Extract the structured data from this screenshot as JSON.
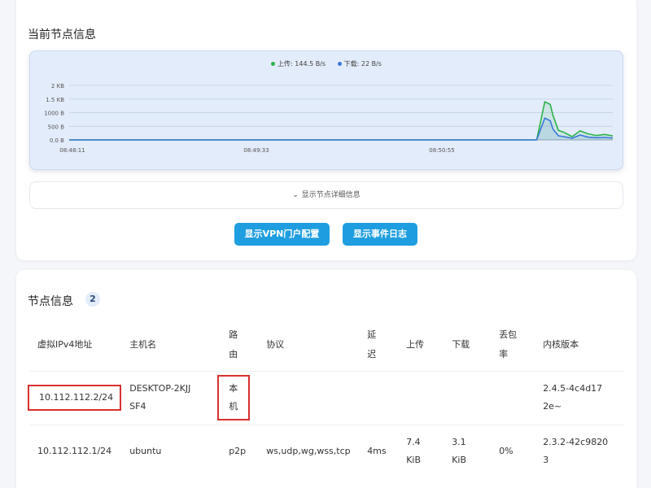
{
  "current_node": {
    "title": "当前节点信息",
    "detail_toggle": "显示节点详细信息",
    "buttons": {
      "vpn": "显示VPN门户配置",
      "log": "显示事件日志"
    }
  },
  "chart_data": {
    "type": "line",
    "series": [
      {
        "name": "上传: 144.5 B/s",
        "color": "#2bb34a",
        "x": [
          0,
          0.5,
          0.86,
          0.875,
          0.885,
          0.89,
          0.9,
          0.91,
          0.925,
          0.94,
          0.955,
          0.97,
          0.985,
          1
        ],
        "y": [
          0,
          0,
          0,
          1400,
          1300,
          900,
          350,
          280,
          120,
          330,
          220,
          160,
          200,
          150
        ]
      },
      {
        "name": "下载: 22 B/s",
        "color": "#3a78d8",
        "x": [
          0,
          0.5,
          0.86,
          0.875,
          0.885,
          0.89,
          0.9,
          0.91,
          0.925,
          0.94,
          0.955,
          0.97,
          0.985,
          1
        ],
        "y": [
          0,
          0,
          0,
          800,
          700,
          400,
          150,
          120,
          60,
          180,
          100,
          80,
          90,
          70
        ]
      }
    ],
    "y_ticks": [
      "2 KB",
      "1.5 KB",
      "1000 B",
      "500 B",
      "0.0 B"
    ],
    "x_ticks": [
      "08:48:11",
      "08:49:33",
      "08:50:55"
    ],
    "ylim": [
      0,
      2000
    ],
    "grid": true,
    "legend": "top"
  },
  "nodes": {
    "title": "节点信息",
    "count": "2",
    "columns": [
      "虚拟IPv4地址",
      "主机名",
      "路由",
      "协议",
      "延迟",
      "上传",
      "下载",
      "丢包率",
      "内核版本"
    ],
    "rows": [
      {
        "ip": "10.112.112.2/24",
        "hostname": "DESKTOP-2KJJSF4",
        "route": "本机",
        "protocol": "",
        "latency": "",
        "upload": "",
        "download": "",
        "loss": "",
        "version": "2.4.5-4c4d172e~"
      },
      {
        "ip": "10.112.112.1/24",
        "hostname": "ubuntu",
        "route": "p2p",
        "protocol": "ws,udp,wg,wss,tcp",
        "latency": "4ms",
        "upload": "7.4 KiB",
        "download": "3.1 KiB",
        "loss": "0%",
        "version": "2.3.2-42c98203"
      }
    ]
  }
}
